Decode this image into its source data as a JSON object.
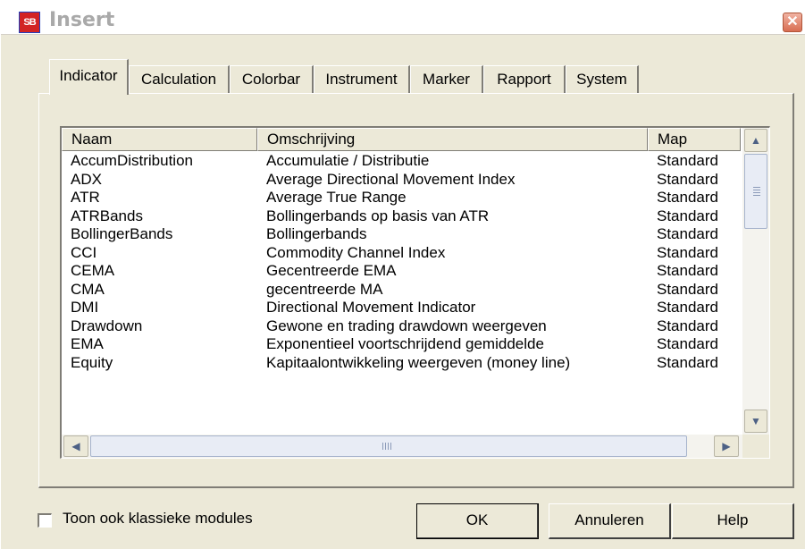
{
  "window": {
    "title": "Insert",
    "app_icon_text": "SB",
    "close_glyph": "✕"
  },
  "tabs": [
    {
      "label": "Indicator",
      "active": true
    },
    {
      "label": "Calculation",
      "active": false
    },
    {
      "label": "Colorbar",
      "active": false
    },
    {
      "label": "Instrument",
      "active": false
    },
    {
      "label": "Marker",
      "active": false
    },
    {
      "label": "Rapport",
      "active": false
    },
    {
      "label": "System",
      "active": false
    }
  ],
  "list": {
    "columns": [
      "Naam",
      "Omschrijving",
      "Map"
    ],
    "rows": [
      [
        "AccumDistribution",
        "Accumulatie / Distributie",
        "Standard"
      ],
      [
        "ADX",
        "Average Directional Movement Index",
        "Standard"
      ],
      [
        "ATR",
        "Average True Range",
        "Standard"
      ],
      [
        "ATRBands",
        "Bollingerbands op basis van ATR",
        "Standard"
      ],
      [
        "BollingerBands",
        "Bollingerbands",
        "Standard"
      ],
      [
        "CCI",
        "Commodity Channel Index",
        "Standard"
      ],
      [
        "CEMA",
        "Gecentreerde EMA",
        "Standard"
      ],
      [
        "CMA",
        "gecentreerde MA",
        "Standard"
      ],
      [
        "DMI",
        "Directional Movement Indicator",
        "Standard"
      ],
      [
        "Drawdown",
        "Gewone en trading drawdown weergeven",
        "Standard"
      ],
      [
        "EMA",
        "Exponentieel voortschrijdend gemiddelde",
        "Standard"
      ],
      [
        "Equity",
        "Kapitaalontwikkeling weergeven (money line)",
        "Standard"
      ]
    ]
  },
  "scrollbar": {
    "up_glyph": "▲",
    "down_glyph": "▼",
    "left_glyph": "◀",
    "right_glyph": "▶"
  },
  "footer": {
    "checkbox_label": "Toon ook klassieke modules",
    "checkbox_checked": false,
    "ok_label": "OK",
    "cancel_label": "Annuleren",
    "help_label": "Help"
  }
}
